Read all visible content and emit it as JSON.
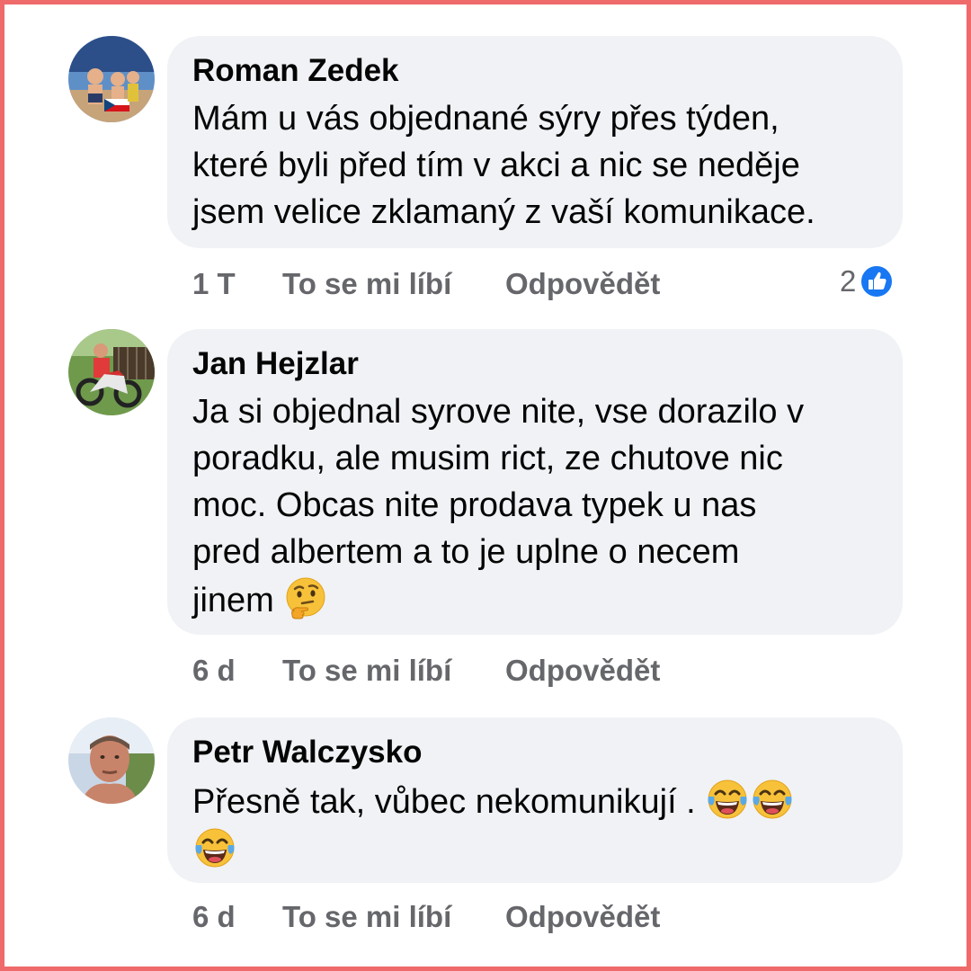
{
  "comments": [
    {
      "author": "Roman Zedek",
      "text": "Mám u vás objednané sýry přes týden,\nkteré byli před tím v akci a nic se neděje\njsem velice zklamaný z vaší komunikace.",
      "time": "1 T",
      "like_label": "To se mi líbí",
      "reply_label": "Odpovědět",
      "reaction_count": "2",
      "reaction_icon": "like-icon"
    },
    {
      "author": "Jan Hejzlar",
      "text": "Ja si objednal syrove nite, vse dorazilo v\nporadku, ale musim rict, ze chutove nic\nmoc. Obcas nite prodava typek u nas\npred albertem a to je uplne o necem\njinem ",
      "emoji": "thinking-face-emoji",
      "time": "6 d",
      "like_label": "To se mi líbí",
      "reply_label": "Odpovědět"
    },
    {
      "author": "Petr Walczysko",
      "text": "Přesně tak, vůbec nekomunikují . ",
      "emoji": "tears-of-joy-emoji",
      "time": "6 d",
      "like_label": "To se mi líbí",
      "reply_label": "Odpovědět"
    }
  ],
  "colors": {
    "frame": "#ef6a6a",
    "bubble": "#f0f2f5",
    "meta_text": "#65676b",
    "like_blue": "#1877f2"
  }
}
